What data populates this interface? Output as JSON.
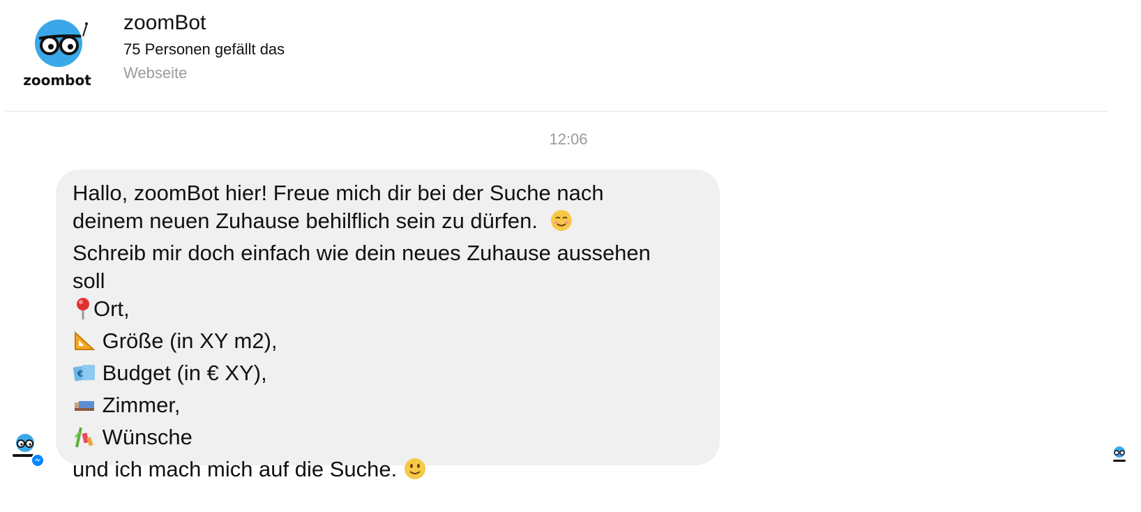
{
  "header": {
    "page_name": "zoomBot",
    "likes": "75 Personen gefällt das",
    "category": "Webseite",
    "logo_text": "zoombot"
  },
  "conversation": {
    "timestamp": "12:06",
    "message": {
      "lines": [
        {
          "text": "Hallo, zoomBot hier! Freue mich dir bei der Suche nach",
          "icon": null
        },
        {
          "text": "deinem neuen Zuhause behilflich sein zu dürfen.",
          "icon": "smiling-blush-emoji"
        },
        {
          "text": "Schreib mir doch einfach wie dein neues Zuhause aussehen",
          "icon": null
        },
        {
          "text": "soll",
          "icon": null
        },
        {
          "text": "Ort,",
          "icon": "round-pushpin-emoji"
        },
        {
          "text": " Größe (in XY m2),",
          "icon": "triangular-ruler-emoji"
        },
        {
          "text": "  Budget (in € XY),",
          "icon": "euro-banknote-emoji"
        },
        {
          "text": " Zimmer,",
          "icon": "bed-emoji"
        },
        {
          "text": " Wünsche",
          "icon": "tanabata-tree-emoji"
        },
        {
          "text": "und ich mach mich auf die Suche.",
          "icon": "slightly-smiling-emoji"
        }
      ]
    }
  },
  "colors": {
    "bubble": "#f0f0f0",
    "timestamp": "#999999",
    "brand_blue": "#3aa8e8",
    "messenger_blue": "#0084ff"
  }
}
